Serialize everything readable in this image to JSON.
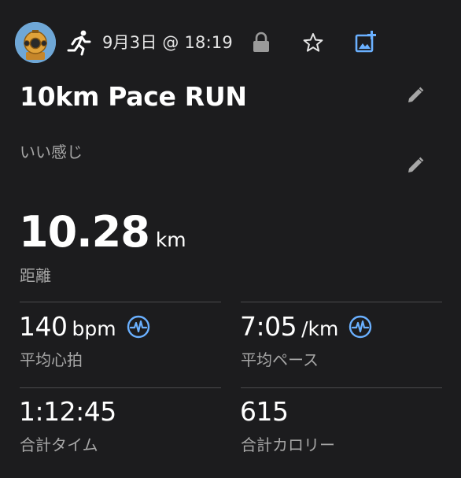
{
  "header": {
    "date_time": "9月3日 @ 18:19",
    "icons": {
      "avatar": "diving-helmet-avatar",
      "activity": "running-icon",
      "lock": "lock-icon",
      "favorite": "star-icon",
      "add_photo": "add-photo-icon"
    }
  },
  "activity": {
    "title": "10km Pace RUN",
    "note": "いい感じ"
  },
  "distance": {
    "value": "10.28",
    "unit": "km",
    "label": "距離"
  },
  "stats": {
    "avg_hr": {
      "value": "140",
      "unit": "bpm",
      "label": "平均心拍"
    },
    "avg_pace": {
      "value": "7:05",
      "unit": "/km",
      "label": "平均ペース"
    },
    "total_time": {
      "value": "1:12:45",
      "label": "合計タイム"
    },
    "calories": {
      "value": "615",
      "label": "合計カロリー"
    }
  },
  "colors": {
    "background": "#1c1c1e",
    "accent_blue": "#6ab0ff",
    "secondary_text": "#a6a6a6",
    "divider": "#4a4a4c"
  }
}
